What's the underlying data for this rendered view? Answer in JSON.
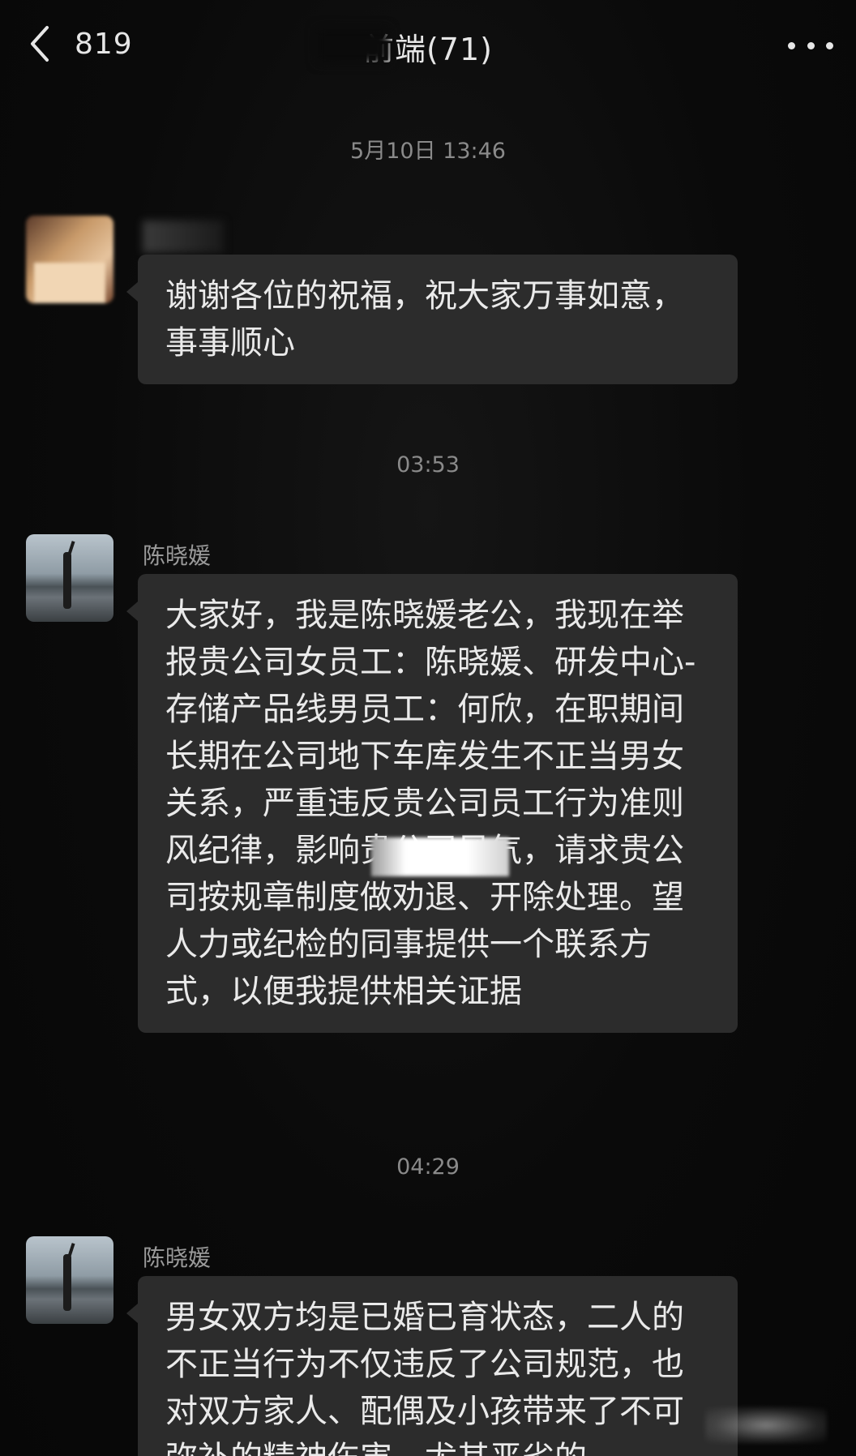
{
  "header": {
    "back_icon": "chevron-left-icon",
    "unread_count": "819",
    "title": "前端(71)",
    "more_icon": "more-dots-icon"
  },
  "messages": [
    {
      "timestamp": "5月10日 13:46",
      "sender": "",
      "text": "谢谢各位的祝福，祝大家万事如意，事事顺心"
    },
    {
      "timestamp": "03:53",
      "sender": "陈晓媛",
      "text": "大家好，我是陈晓媛老公，我现在举报贵公司女员工：陈晓媛、研发中心-存储产品线男员工：何欣，在职期间长期在公司地下车库发生不正当男女关系，严重违反贵公司员工行为准则 风纪律，影响贵公司风气，请求贵公司按规章制度做劝退、开除处理。望人力或纪检的同事提供一个联系方式，以便我提供相关证据"
    },
    {
      "timestamp": "04:29",
      "sender": "陈晓媛",
      "text": "男女双方均是已婚已育状态，二人的不正当行为不仅违反了公司规范，也对双方家人、配偶及小孩带来了不可弥补的精神伤害，尤其恶劣的"
    }
  ],
  "colors": {
    "background": "#0b0b0b",
    "bubble": "#2c2c2c",
    "text": "#eaeaea",
    "timestamp": "#8a8a8a",
    "sender": "#9a9a9a"
  }
}
